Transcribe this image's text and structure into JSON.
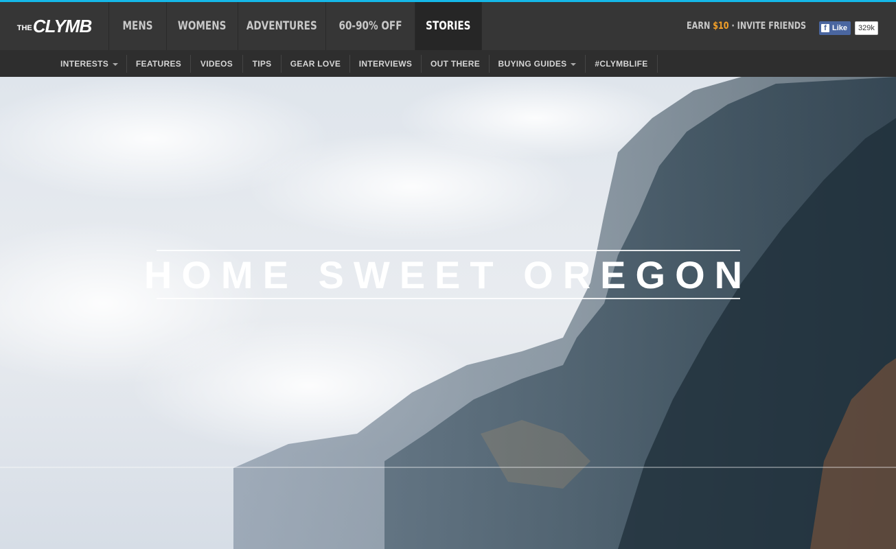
{
  "brand": {
    "the": "THE",
    "clymb": "CLYMB",
    "accent_color": "#15b8e8"
  },
  "main_nav": [
    {
      "label": "MENS",
      "active": false
    },
    {
      "label": "WOMENS",
      "active": false
    },
    {
      "label": "ADVENTURES",
      "active": false
    },
    {
      "label": "60-90% OFF",
      "active": false
    },
    {
      "label": "STORIES",
      "active": true
    }
  ],
  "referral": {
    "prefix": "EARN ",
    "amount": "$10",
    "suffix": " · INVITE FRIENDS",
    "amount_color": "#f3a028"
  },
  "facebook": {
    "like_label": "Like",
    "count": "329k",
    "icon": "facebook-f-icon"
  },
  "sub_nav": [
    {
      "label": "INTERESTS",
      "dropdown": true
    },
    {
      "label": "FEATURES",
      "dropdown": false
    },
    {
      "label": "VIDEOS",
      "dropdown": false
    },
    {
      "label": "TIPS",
      "dropdown": false
    },
    {
      "label": "GEAR LOVE",
      "dropdown": false
    },
    {
      "label": "INTERVIEWS",
      "dropdown": false
    },
    {
      "label": "OUT THERE",
      "dropdown": false
    },
    {
      "label": "BUYING GUIDES",
      "dropdown": true
    },
    {
      "label": "#CLYMBLIFE",
      "dropdown": false
    }
  ],
  "hero": {
    "title": "HOME SWEET OREGON"
  }
}
